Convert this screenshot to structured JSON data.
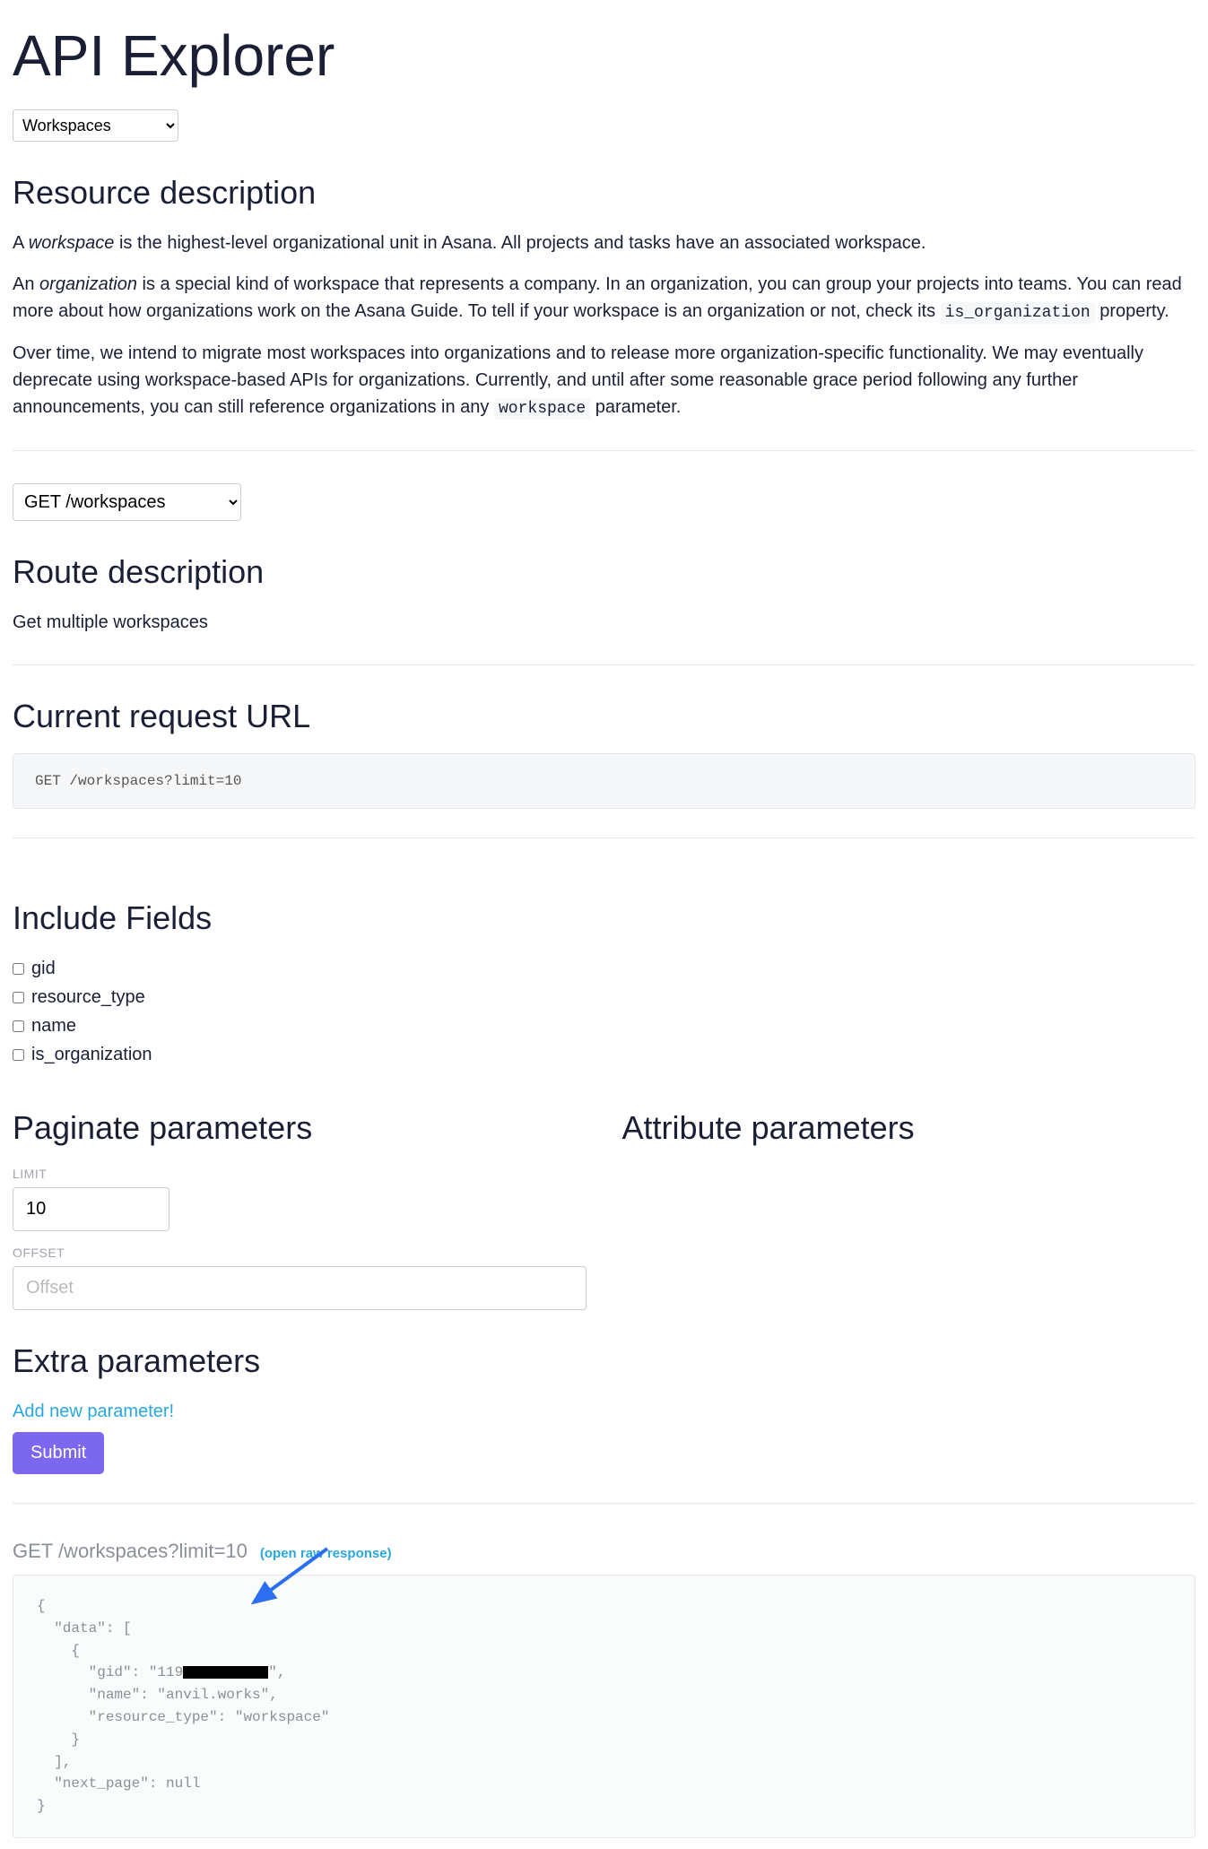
{
  "page_title": "API Explorer",
  "resource_select": "Workspaces",
  "resource_desc": {
    "heading": "Resource description",
    "p1_pre": "A ",
    "p1_em": "workspace",
    "p1_post": " is the highest-level organizational unit in Asana. All projects and tasks have an associated workspace.",
    "p2_pre": "An ",
    "p2_em": "organization",
    "p2_mid": " is a special kind of workspace that represents a company. In an organization, you can group your projects into teams. You can read more about how organizations work on the Asana Guide. To tell if your workspace is an organization or not, check its ",
    "p2_code": "is_organization",
    "p2_post": " property.",
    "p3_pre": "Over time, we intend to migrate most workspaces into organizations and to release more organization-specific functionality. We may eventually deprecate using workspace-based APIs for organizations. Currently, and until after some reasonable grace period following any further announcements, you can still reference organizations in any ",
    "p3_code": "workspace",
    "p3_post": " parameter."
  },
  "route_select": "GET /workspaces",
  "route_desc": {
    "heading": "Route description",
    "text": "Get multiple workspaces"
  },
  "current_url": {
    "heading": "Current request URL",
    "value": "GET /workspaces?limit=10"
  },
  "include_fields": {
    "heading": "Include Fields",
    "items": [
      "gid",
      "resource_type",
      "name",
      "is_organization"
    ]
  },
  "paginate": {
    "heading": "Paginate parameters",
    "limit_label": "Limit",
    "limit_value": "10",
    "offset_label": "Offset",
    "offset_placeholder": "Offset"
  },
  "attribute": {
    "heading": "Attribute parameters"
  },
  "extra": {
    "heading": "Extra parameters",
    "add_link": "Add new parameter!",
    "submit": "Submit"
  },
  "response": {
    "request_line": "GET /workspaces?limit=10",
    "raw_link": "(open raw response)",
    "body_l1": "{",
    "body_l2": "  \"data\": [",
    "body_l3": "    {",
    "body_l4a": "      \"gid\": \"119",
    "body_l4b": "\",",
    "body_l5": "      \"name\": \"anvil.works\",",
    "body_l6": "      \"resource_type\": \"workspace\"",
    "body_l7": "    }",
    "body_l8": "  ],",
    "body_l9": "  \"next_page\": null",
    "body_l10": "}"
  }
}
